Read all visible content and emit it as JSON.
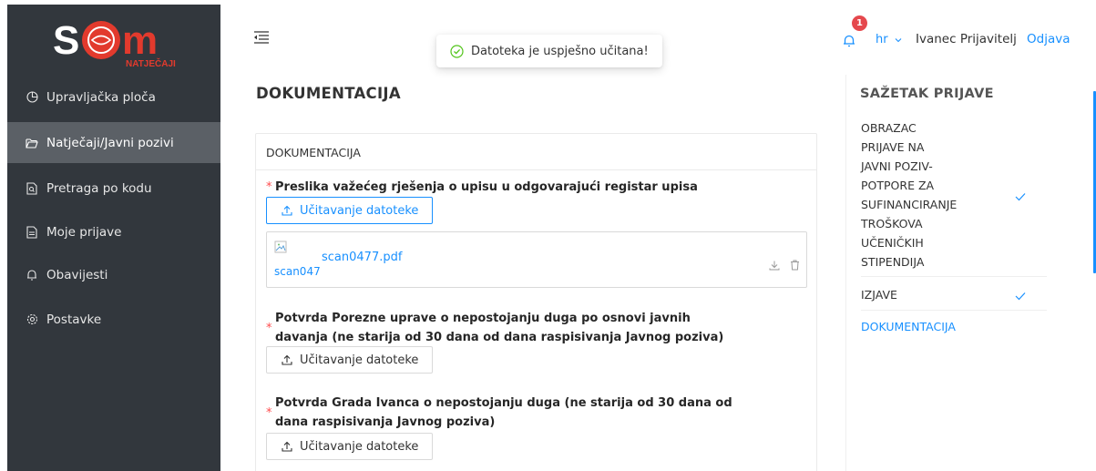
{
  "app": {
    "logo_text": "SOM",
    "logo_subtext": "NATJEČAJI"
  },
  "sidebar": {
    "items": [
      {
        "label": "Upravljačka ploča",
        "icon": "dashboard-icon"
      },
      {
        "label": "Natječaji/Javni pozivi",
        "icon": "folder-open-icon",
        "active": true
      },
      {
        "label": "Pretraga po kodu",
        "icon": "file-search-icon"
      },
      {
        "label": "Moje prijave",
        "icon": "file-text-icon"
      },
      {
        "label": "Obavijesti",
        "icon": "bell-icon"
      },
      {
        "label": "Postavke",
        "icon": "gear-icon"
      }
    ]
  },
  "header": {
    "notification_count": "1",
    "language": "hr",
    "user_name": "Ivanec Prijavitelj",
    "logout_label": "Odjava"
  },
  "toast": {
    "message": "Datoteka je uspješno učitana!",
    "type": "success"
  },
  "main": {
    "page_title": "DOKUMENTACIJA",
    "card_title": "DOKUMENTACIJA",
    "requirements": [
      {
        "label": "Preslika važećeg rješenja o upisu u odgovarajući registar upisa",
        "upload_label": "Učitavanje datoteke",
        "required": true,
        "files": [
          {
            "name": "scan0477.pdf",
            "thumb_alt": "scan0477.pdf"
          }
        ]
      },
      {
        "label_line1": "Potvrda Porezne uprave o nepostojanju duga po osnovi javnih",
        "label_line2": "davanja (ne starija od 30 dana od dana raspisivanja Javnog poziva)",
        "upload_label": "Učitavanje datoteke",
        "required": true
      },
      {
        "label_line1": "Potvrda Grada Ivanca o nepostojanju duga (ne starija od 30 dana od",
        "label_line2": "dana raspisivanja Javnog poziva)",
        "upload_label": "Učitavanje datoteke",
        "required": true
      }
    ]
  },
  "summary": {
    "title": "SAŽETAK PRIJAVE",
    "items": [
      {
        "lines": [
          "OBRAZAC",
          "PRIJAVE NA",
          "JAVNI POZIV-",
          "POTPORE ZA",
          "SUFINANCIRANJE",
          "TROŠKOVA",
          "UČENIČKIH",
          "STIPENDIJA"
        ],
        "done": true
      },
      {
        "lines": [
          "IZJAVE"
        ],
        "done": true
      },
      {
        "lines": [
          "DOKUMENTACIJA"
        ],
        "done": false,
        "current": true
      }
    ]
  },
  "colors": {
    "sidebar_bg": "#32373d",
    "sidebar_active": "#5b6066",
    "accent": "#1890ff",
    "required": "#ff4d4f",
    "success": "#52c41a",
    "logo_red": "#e23a2d"
  }
}
